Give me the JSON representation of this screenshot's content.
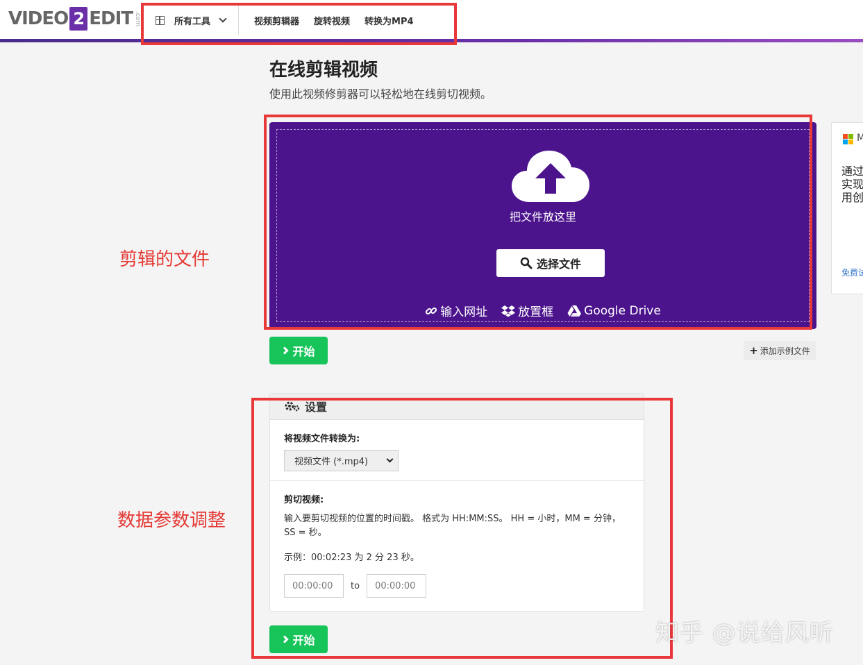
{
  "logo": {
    "left": "VIDEO",
    "two": "2",
    "right": "EDIT",
    "com": ".com"
  },
  "nav": {
    "all_tools": "所有工具",
    "links": [
      "视频剪辑器",
      "旋转视频",
      "转换为MP4"
    ]
  },
  "page": {
    "title": "在线剪辑视频",
    "subtitle": "使用此视频修剪器可以轻松地在线剪切视频。"
  },
  "upload": {
    "drop_text": "把文件放这里",
    "choose_label": "选择文件",
    "sources": [
      {
        "icon": "link-icon",
        "label": "输入网址"
      },
      {
        "icon": "dropbox-icon",
        "label": "放置框"
      },
      {
        "icon": "google-drive-icon",
        "label": "Google Drive"
      }
    ]
  },
  "actions": {
    "start_label": "开始",
    "sample_label": "添加示例文件"
  },
  "ad": {
    "brand_initial": "M",
    "text": "通过实现用创",
    "link": "免费试"
  },
  "settings": {
    "title": "设置",
    "convert_label": "将视频文件转换为:",
    "format_selected": "视频文件 (*.mp4)",
    "cut_label": "剪切视频:",
    "cut_desc": "输入要剪切视频的位置的时间戳。 格式为 HH:MM:SS。 HH = 小时，MM = 分钟，SS = 秒。",
    "example": "示例：00:02:23 为 2 分 23 秒。",
    "start_placeholder": "00:00:00",
    "to_label": "to",
    "end_placeholder": "00:00:00"
  },
  "annotations": {
    "file_label": "剪辑的文件",
    "params_label": "数据参数调整",
    "color": "#e8383a"
  },
  "watermark": "知乎 @说给风听",
  "colors": {
    "brand_purple": "#4b148c",
    "start_green": "#17c45a"
  }
}
